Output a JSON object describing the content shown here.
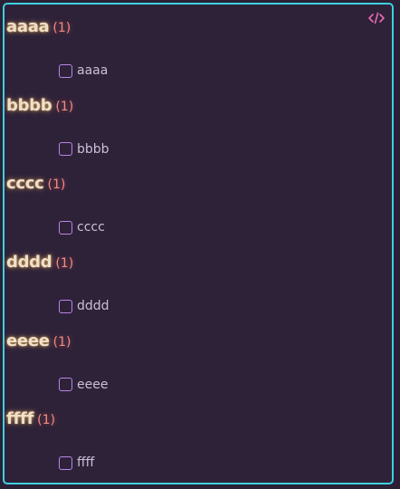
{
  "toolbar": {
    "code_icon": "code-icon",
    "code_icon_color": "#e86bb0"
  },
  "groups": [
    {
      "title": "aaaa",
      "count": "(1)",
      "tasks": [
        {
          "label": "aaaa",
          "checked": false
        }
      ]
    },
    {
      "title": "bbbb",
      "count": "(1)",
      "tasks": [
        {
          "label": "bbbb",
          "checked": false
        }
      ]
    },
    {
      "title": "cccc",
      "count": "(1)",
      "tasks": [
        {
          "label": "cccc",
          "checked": false
        }
      ]
    },
    {
      "title": "dddd",
      "count": "(1)",
      "tasks": [
        {
          "label": "dddd",
          "checked": false
        }
      ]
    },
    {
      "title": "eeee",
      "count": "(1)",
      "tasks": [
        {
          "label": "eeee",
          "checked": false
        }
      ]
    },
    {
      "title": "ffff",
      "count": "(1)",
      "tasks": [
        {
          "label": "ffff",
          "checked": false
        }
      ]
    }
  ],
  "colors": {
    "border": "#3fd0e0",
    "background": "#2e2239",
    "title": "#efe0c8",
    "count": "#f08a82",
    "checkbox": "#b985e8",
    "task_text": "#cbbfd8"
  }
}
